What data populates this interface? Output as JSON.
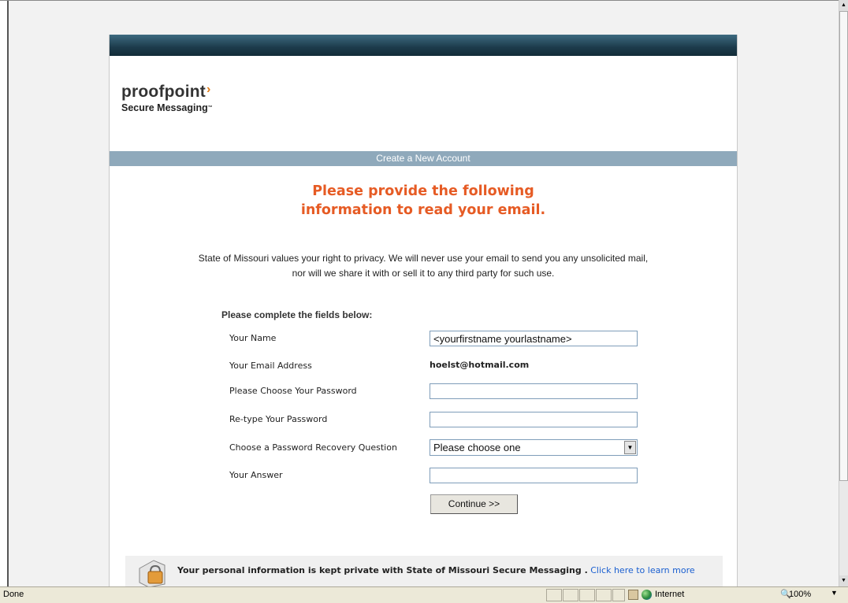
{
  "page": {
    "title_bar": "Create a New Account",
    "headline_line1": "Please provide the following",
    "headline_line2": "information to read your email.",
    "privacy_line1": "State of Missouri values your right to privacy. We will never use your email to send you any unsolicited mail,",
    "privacy_line2": "nor will we share it with or sell it to any third party for such use."
  },
  "logo": {
    "word": "proofpoint",
    "subtitle": "Secure Messaging"
  },
  "form": {
    "heading": "Please complete the fields below:",
    "name_label": "Your Name",
    "name_value": "<yourfirstname yourlastname>",
    "email_label": "Your Email Address",
    "email_value": "hoelst@hotmail.com",
    "password_label": "Please Choose Your Password",
    "retype_label": "Re-type Your Password",
    "question_label": "Choose a Password Recovery Question",
    "question_selected": "Please choose one",
    "answer_label": "Your Answer",
    "continue_label": "Continue >>"
  },
  "footer": {
    "bold_text": "Your personal information is kept private with State of Missouri Secure Messaging .",
    "link_text": "Click here to learn more"
  },
  "status": {
    "text": "Done",
    "zone": "Internet",
    "zoom": "100%"
  },
  "icons": {
    "lock": "lock-icon",
    "globe": "globe-icon",
    "zoom": "zoom-icon",
    "dropdown": "chevron-down-icon"
  },
  "colors": {
    "headline": "#e65b24",
    "title_bar": "#8fa9bb",
    "top_band": "#1c3b4b",
    "link": "#1a5fd0",
    "logo_chevron": "#e07b17"
  }
}
